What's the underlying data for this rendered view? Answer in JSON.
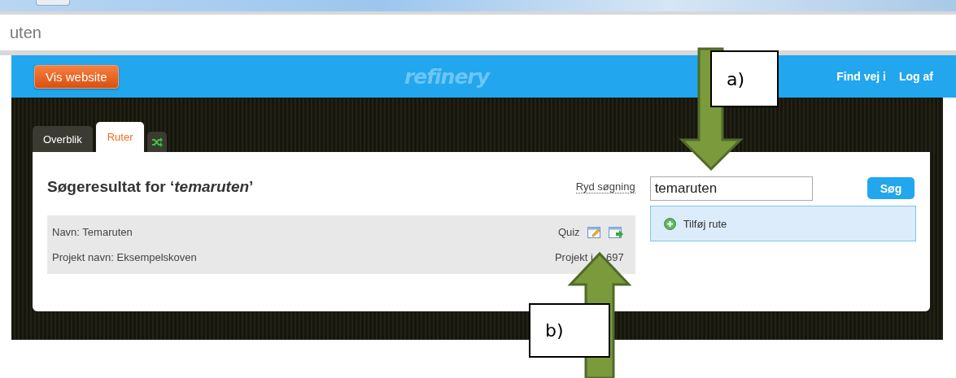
{
  "browser": {
    "address_fragment": "uten"
  },
  "header": {
    "button": "Vis website",
    "logo": "refinery",
    "links": [
      "Find vej i",
      "Log af"
    ]
  },
  "tabs": [
    {
      "kind": "text",
      "label": "Overblik",
      "selected": false
    },
    {
      "kind": "text",
      "label": "Ruter",
      "selected": true
    },
    {
      "kind": "icon",
      "selected": false
    }
  ],
  "search_results": {
    "heading": "Søgeresultat for ‘*temaruten*’",
    "clear_link": "Ryd søgning",
    "results": [
      {
        "name": "Navn: Temaruten",
        "quiz_label": "Quiz",
        "project_name": "Projekt navn: Eksempelskoven",
        "project_id_parts": [
          "Projekt i",
          "697"
        ]
      }
    ]
  },
  "search": {
    "value": "temaruten",
    "button": "Søg"
  },
  "actions": [
    {
      "label": "Tilføj rute"
    }
  ],
  "annotations": [
    {
      "label": "a)"
    },
    {
      "label": "b)"
    }
  ]
}
